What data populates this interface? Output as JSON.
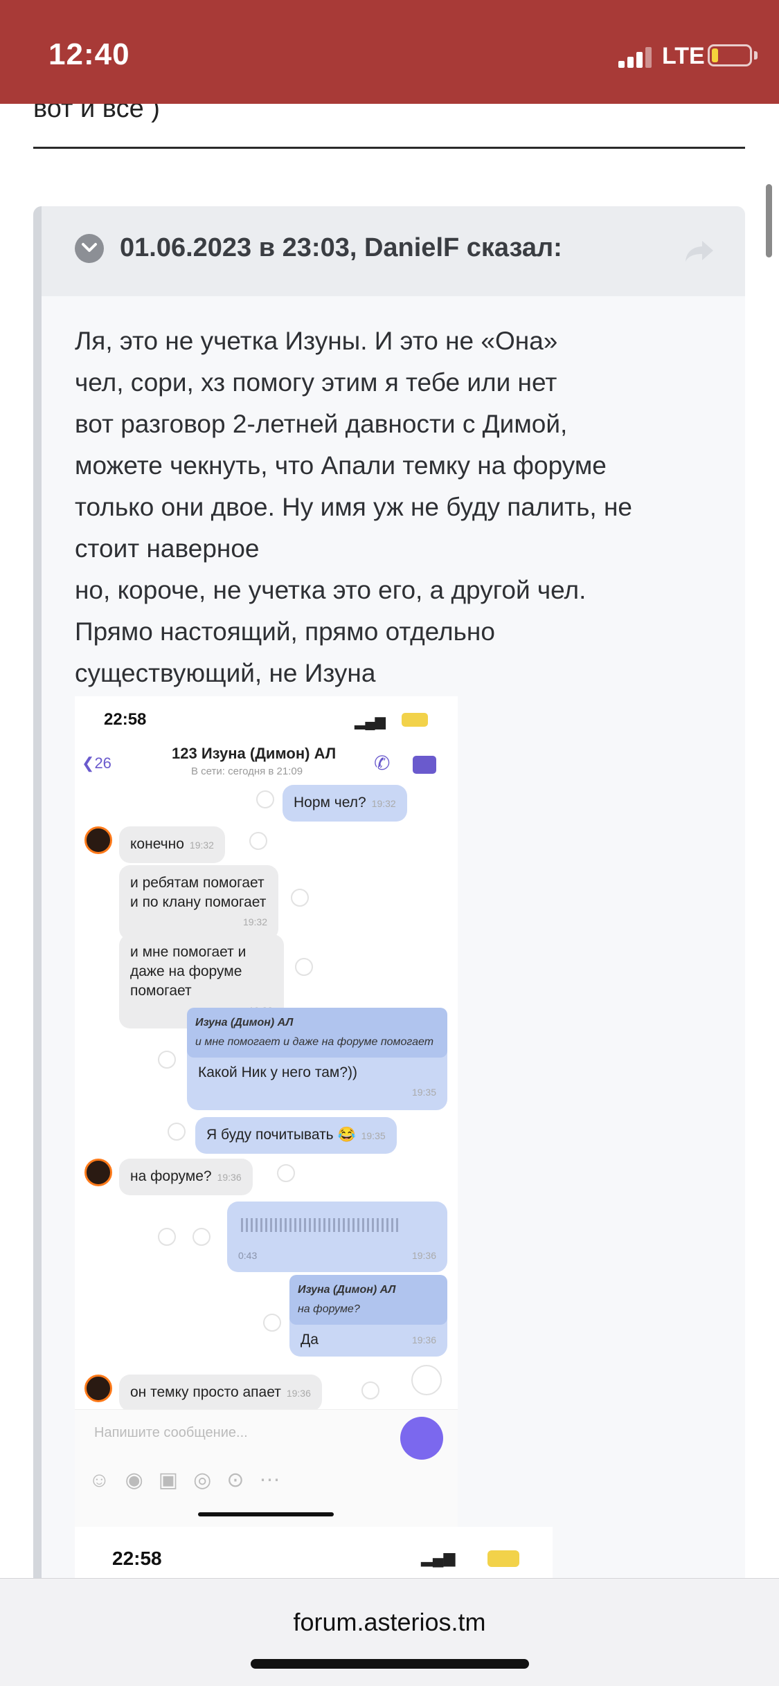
{
  "status_bar": {
    "time": "12:40",
    "network": "LTE"
  },
  "post": {
    "prev_text": "вот и все )",
    "quote_attribution": "01.06.2023 в 23:03, DanielF сказал:",
    "quote_lines": [
      "Ля, это не учетка Изуны. И это не «Она»",
      "чел, сори, хз помогу этим я тебе или нет",
      "вот разговор 2-летней давности с Димой,",
      "можете чекнуть, что Апали темку на форуме",
      "только они двое. Ну имя уж не буду палить, не",
      "стоит наверное",
      "но, короче, не учетка это его, а другой чел.",
      "Прямо настоящий, прямо отдельно",
      "существующий, не Изуна"
    ]
  },
  "screenshot": {
    "time": "22:58",
    "back_count": "26",
    "chat_title": "123 Изуна (Димон) АЛ",
    "chat_status": "В сети: сегодня в 21:09",
    "messages": [
      {
        "text": "Норм чел?",
        "time": "19:32"
      },
      {
        "text": "конечно",
        "time": "19:32"
      },
      {
        "text": "и ребятам помогает и по клану помогает",
        "time": "19:32"
      },
      {
        "text": "и мне помогает и даже на форуме помогает",
        "time": "19:33"
      },
      {
        "reply_author": "Изуна (Димон) АЛ",
        "reply_text": "и мне помогает и даже на форуме помогает",
        "text": "Какой Ник у него там?))",
        "time": "19:35"
      },
      {
        "text": "Я буду почитывать 😂",
        "time": "19:35"
      },
      {
        "text": "на форуме?",
        "time": "19:36"
      },
      {
        "voice_duration": "0:43",
        "time": "19:36"
      },
      {
        "reply_author": "Изуна (Димон) АЛ",
        "reply_text": "на форуме?",
        "text": "Да",
        "time": "19:36"
      },
      {
        "text": "он темку просто апает",
        "time": "19:36"
      }
    ],
    "input_placeholder": "Напишите сообщение...",
    "second_time": "22:58"
  },
  "browser": {
    "url": "forum.asterios.tm"
  },
  "colors": {
    "status_bar": "#a83a37",
    "accent": "#6a5acd"
  }
}
